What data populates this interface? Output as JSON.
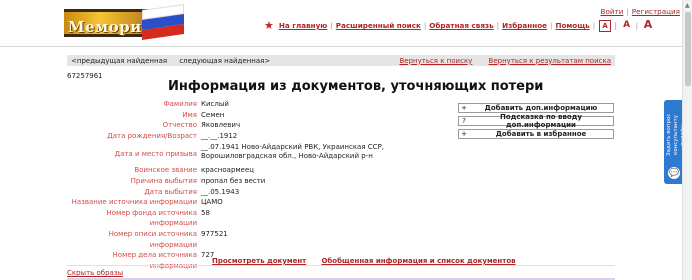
{
  "header": {
    "logo_text": "Мемориал",
    "login": "Войти",
    "register": "Регистрация",
    "nav": [
      "На главную",
      "Расширенный поиск",
      "Обратная связь",
      "Избранное",
      "Помощь"
    ],
    "font_sizes": [
      "A",
      "A",
      "A"
    ]
  },
  "toolbar": {
    "prev": "<предыдущая найденная",
    "next": "следующая найденная>",
    "back_search": "Вернуться к поиску",
    "back_results": "Вернуться к результатам поиска"
  },
  "record_id": "67257961",
  "page_title": "Информация из документов, уточняющих потери",
  "fields": [
    {
      "label": "Фамилия",
      "value": "Кислый"
    },
    {
      "label": "Имя",
      "value": "Семен"
    },
    {
      "label": "Отчество",
      "value": "Яковлевич"
    },
    {
      "label": "Дата рождения/Возраст",
      "value": "__.__.1912"
    },
    {
      "label": "Дата и место призыва",
      "value": "__.07.1941 Ново-Айдарский РВК, Украинская ССР, Ворошиловградская обл., Ново-Айдарский р-н"
    },
    {
      "label": "Воинское звание",
      "value": "красноармеец"
    },
    {
      "label": "Причина выбытия",
      "value": "пропал без вести"
    },
    {
      "label": "Дата выбытия",
      "value": "__.05.1943"
    },
    {
      "label": "Название источника информации",
      "value": "ЦАМО"
    },
    {
      "label": "Номер фонда источника информации",
      "value": "58"
    },
    {
      "label": "Номер описи источника информации",
      "value": "977521"
    },
    {
      "label": "Номер дела источника информации",
      "value": "727"
    }
  ],
  "actions": [
    {
      "icon": "+",
      "label": "Добавить доп.информацию"
    },
    {
      "icon": "?",
      "label": "Подсказка по вводу доп.информации"
    },
    {
      "icon": "+",
      "label": "Добавить в избранное"
    }
  ],
  "bottom": {
    "view_doc": "Просмотреть документ",
    "summary": "Обобщенная информация и список документов",
    "hide_images": "Скрыть образы"
  },
  "feedback": {
    "label": "Задать вопрос консультанту онлайн",
    "icon": "chat-bubble-icon"
  },
  "colors": {
    "link": "#b02525",
    "label": "#d44b4b",
    "feedback": "#2e7ad1"
  }
}
